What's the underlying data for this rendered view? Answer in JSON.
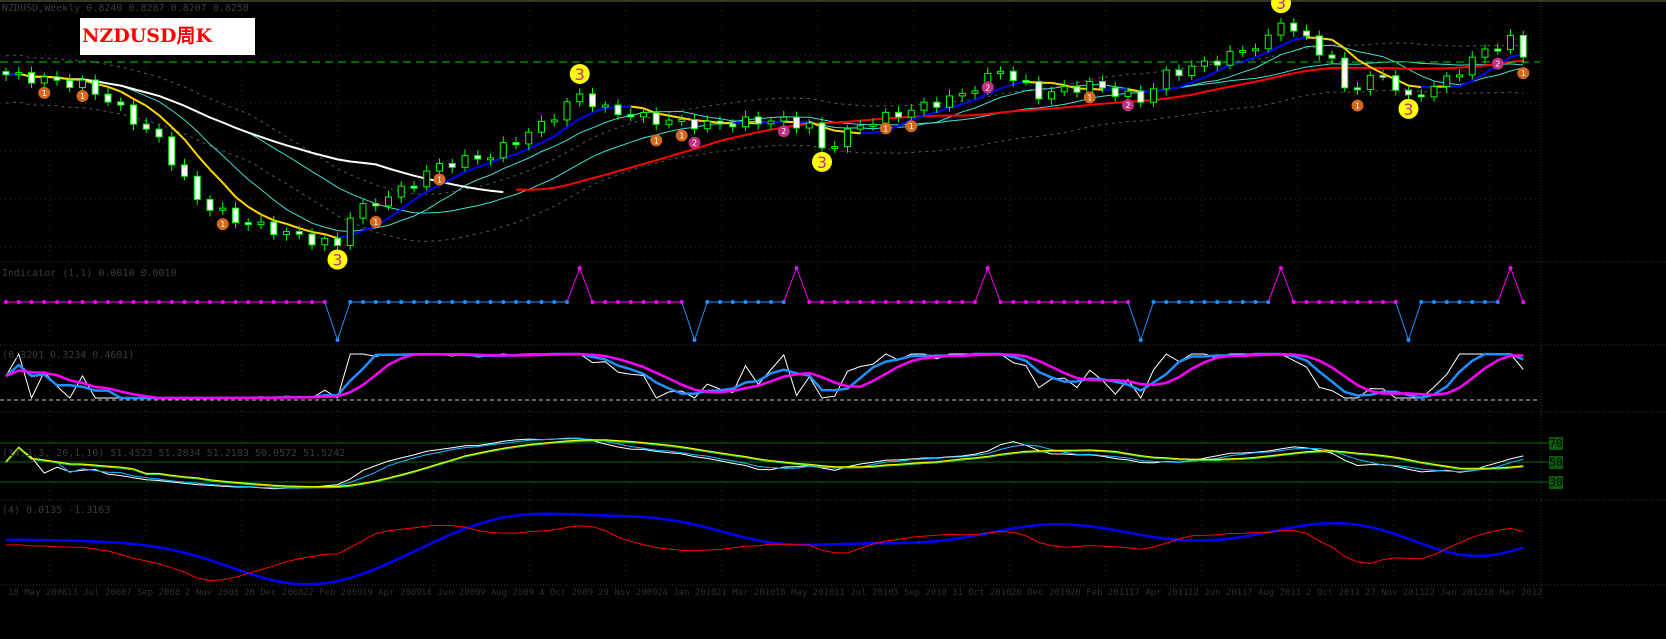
{
  "window": {
    "title": "NZDUSD周K"
  },
  "headers": {
    "main": "NZDUSD,Weekly  0.8240 0.8287 0.8207 0.8258",
    "pane2": "Indicator (1,1)  0.0010 0.0010",
    "pane3": "(0.3201  0.3234  0.4601)",
    "pane4": "(14,3,3, 20,1,10)  51.4523 51.2834  51.2183  50.0572  51.5242",
    "pane5": "(4)  0.0135  -1.3163"
  },
  "rsi_levels": [
    "70",
    "50",
    "30"
  ],
  "colors": {
    "bull": "#00ff00",
    "bear": "#ffffff",
    "ma_slow": "#ff0000",
    "ma_fast_up": "#0000ff",
    "ma_fast_down": "#ffd700",
    "band": "#40e0d0",
    "white_ma": "#ffffff",
    "sig_down": "#ff00ff",
    "sig_up": "#1e90ff"
  },
  "chart_data": {
    "type": "candlestick",
    "symbol": "NZDUSD",
    "timeframe": "Weekly",
    "ylim": [
      0.49,
      0.88
    ],
    "bars": 120,
    "close_anchors": [
      [
        0,
        0.777
      ],
      [
        6,
        0.761
      ],
      [
        8,
        0.737
      ],
      [
        12,
        0.673
      ],
      [
        15,
        0.578
      ],
      [
        18,
        0.546
      ],
      [
        24,
        0.514
      ],
      [
        26,
        0.506
      ],
      [
        27,
        0.554
      ],
      [
        31,
        0.593
      ],
      [
        34,
        0.633
      ],
      [
        38,
        0.649
      ],
      [
        42,
        0.697
      ],
      [
        45,
        0.745
      ],
      [
        47,
        0.721
      ],
      [
        51,
        0.705
      ],
      [
        55,
        0.697
      ],
      [
        60,
        0.705
      ],
      [
        63,
        0.697
      ],
      [
        64,
        0.657
      ],
      [
        67,
        0.697
      ],
      [
        71,
        0.721
      ],
      [
        75,
        0.745
      ],
      [
        78,
        0.785
      ],
      [
        81,
        0.745
      ],
      [
        85,
        0.761
      ],
      [
        89,
        0.737
      ],
      [
        91,
        0.777
      ],
      [
        95,
        0.8
      ],
      [
        99,
        0.832
      ],
      [
        100,
        0.864
      ],
      [
        102,
        0.832
      ],
      [
        104,
        0.8
      ],
      [
        105,
        0.753
      ],
      [
        108,
        0.777
      ],
      [
        110,
        0.737
      ],
      [
        113,
        0.769
      ],
      [
        116,
        0.816
      ],
      [
        118,
        0.832
      ],
      [
        119,
        0.808
      ]
    ],
    "markers": [
      {
        "bar": 26,
        "label": "3",
        "kind": "big"
      },
      {
        "bar": 45,
        "label": "3",
        "kind": "big"
      },
      {
        "bar": 64,
        "label": "3",
        "kind": "big"
      },
      {
        "bar": 100,
        "label": "3",
        "kind": "big"
      },
      {
        "bar": 110,
        "label": "3",
        "kind": "big"
      },
      {
        "bar": 3,
        "label": "1",
        "kind": "orange"
      },
      {
        "bar": 6,
        "label": "1",
        "kind": "orange"
      },
      {
        "bar": 17,
        "label": "1",
        "kind": "orange"
      },
      {
        "bar": 29,
        "label": "1",
        "kind": "orange"
      },
      {
        "bar": 34,
        "label": "1",
        "kind": "orange"
      },
      {
        "bar": 51,
        "label": "1",
        "kind": "orange"
      },
      {
        "bar": 53,
        "label": "1",
        "kind": "orange"
      },
      {
        "bar": 69,
        "label": "1",
        "kind": "orange"
      },
      {
        "bar": 71,
        "label": "1",
        "kind": "orange"
      },
      {
        "bar": 85,
        "label": "1",
        "kind": "orange"
      },
      {
        "bar": 106,
        "label": "1",
        "kind": "orange"
      },
      {
        "bar": 119,
        "label": "1",
        "kind": "orange"
      },
      {
        "bar": 54,
        "label": "2",
        "kind": "pink"
      },
      {
        "bar": 61,
        "label": "2",
        "kind": "pink"
      },
      {
        "bar": 77,
        "label": "2",
        "kind": "pink"
      },
      {
        "bar": 88,
        "label": "2",
        "kind": "pink"
      },
      {
        "bar": 117,
        "label": "2",
        "kind": "pink"
      }
    ],
    "signal_dips": [
      26,
      54,
      89,
      110
    ],
    "signal_peaks": [
      45,
      62,
      77,
      100,
      118
    ],
    "x_tick_labels": [
      "18 May 2008",
      "13 Jul 2008",
      "7 Sep 2008",
      "2 Nov 2008",
      "28 Dec 2008",
      "22 Feb 2009",
      "19 Apr 2009",
      "14 Jun 2009",
      "9 Aug 2009",
      "4 Oct 2009",
      "29 Nov 2009",
      "24 Jan 2010",
      "21 Mar 2010",
      "16 May 2010",
      "11 Jul 2010",
      "5 Sep 2010",
      "31 Oct 2010",
      "26 Dec 2010",
      "20 Feb 2011",
      "17 Apr 2011",
      "12 Jun 2011",
      "7 Aug 2011",
      "2 Oct 2011",
      "27 Nov 2011",
      "22 Jan 2012",
      "18 Mar 2012"
    ]
  }
}
